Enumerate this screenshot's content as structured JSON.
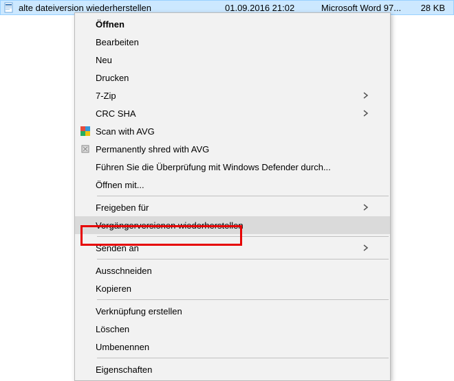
{
  "file": {
    "name": "alte dateiversion wiederherstellen",
    "date": "01.09.2016 21:02",
    "type": "Microsoft Word 97...",
    "size": "28 KB"
  },
  "menu": {
    "open": "Öffnen",
    "edit": "Bearbeiten",
    "new": "Neu",
    "print": "Drucken",
    "sevenzip": "7-Zip",
    "crcsha": "CRC SHA",
    "scan_avg": "Scan with AVG",
    "shred_avg": "Permanently shred with AVG",
    "defender": "Führen Sie die Überprüfung mit Windows Defender durch...",
    "open_with": "Öffnen mit...",
    "share": "Freigeben für",
    "restore_versions": "Vorgängerversionen wiederherstellen",
    "send_to": "Senden an",
    "cut": "Ausschneiden",
    "copy": "Kopieren",
    "create_shortcut": "Verknüpfung erstellen",
    "delete": "Löschen",
    "rename": "Umbenennen",
    "properties": "Eigenschaften"
  }
}
